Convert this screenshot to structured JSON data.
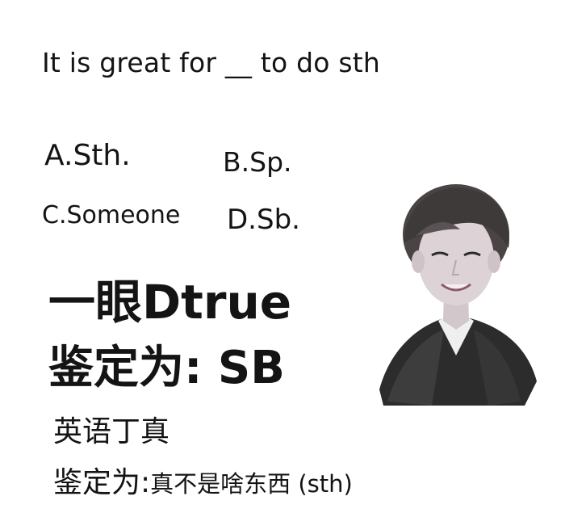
{
  "question": {
    "text": "It is great for __ to do sth"
  },
  "options": {
    "a": "A.Sth.",
    "b": "B.Sp.",
    "c": "C.Someone",
    "d": "D.Sb."
  },
  "verdict": {
    "line1": "一眼Dtrue",
    "line2": "鉴定为: SB",
    "line3": "英语丁真",
    "line4_prefix": "鉴定为:",
    "line4_suffix": "真不是啥东西 (sth)"
  },
  "colors": {
    "text": "#141414",
    "background": "#ffffff"
  },
  "icons": {
    "portrait": "person-portrait-icon"
  }
}
